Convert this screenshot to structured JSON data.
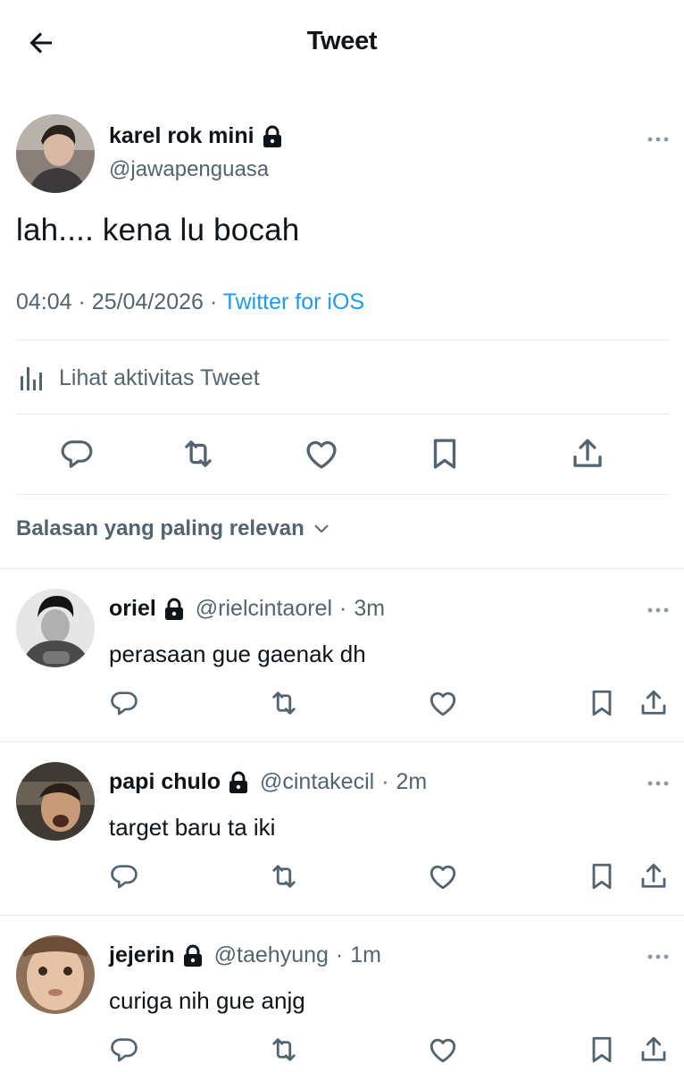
{
  "header": {
    "title": "Tweet",
    "back_icon": "arrow-left-icon"
  },
  "tweet": {
    "author_name": "karel rok mini",
    "author_handle": "@jawapenguasa",
    "text": "lah.... kena lu bocah",
    "time": "04:04",
    "date": "25/04/2026",
    "separator": "·",
    "source": "Twitter for iOS",
    "source_color": "#1d9bf0"
  },
  "activity": {
    "label": "Lihat aktivitas Tweet",
    "icon": "bar-chart-icon"
  },
  "actions": [
    "reply-icon",
    "retweet-icon",
    "like-icon",
    "bookmark-icon",
    "share-icon"
  ],
  "sort": {
    "label": "Balasan yang paling relevan"
  },
  "replies": [
    {
      "name": "oriel",
      "handle": "@rielcintaorel",
      "time": "3m",
      "text": "perasaan gue gaenak dh"
    },
    {
      "name": "papi chulo",
      "handle": "@cintakecil",
      "time": "2m",
      "text": "target baru ta iki"
    },
    {
      "name": "jejerin",
      "handle": "@taehyung",
      "time": "1m",
      "text": "curiga nih gue anjg"
    }
  ],
  "colors": {
    "text": "#0f1419",
    "secondary": "#536471",
    "divider": "#e6e9ec"
  }
}
